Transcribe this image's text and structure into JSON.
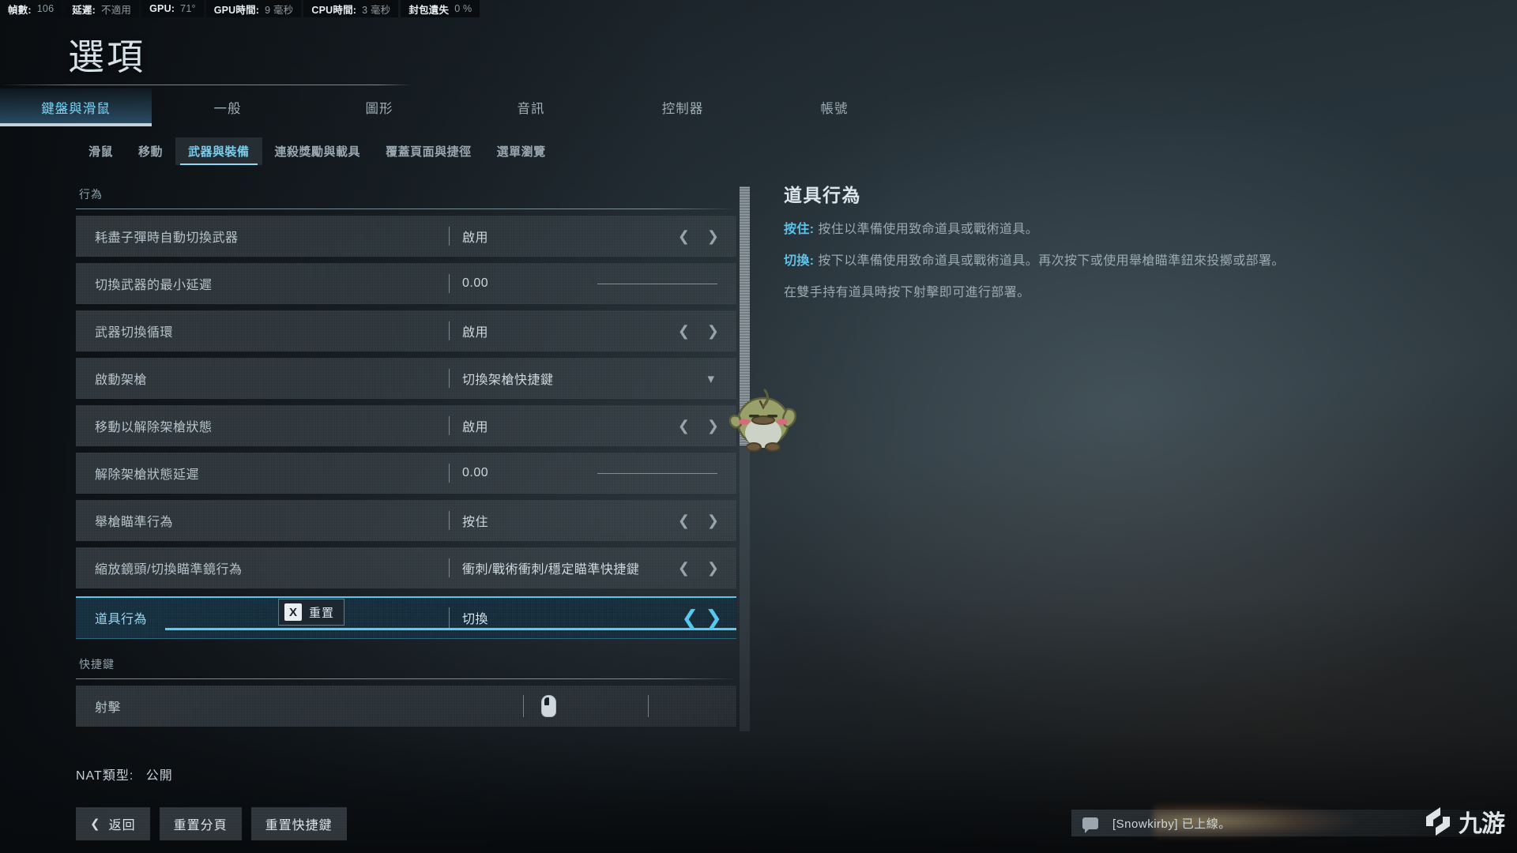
{
  "perf": [
    {
      "key": "幀數:",
      "value": "106"
    },
    {
      "key": "延遲:",
      "value": "不適用"
    },
    {
      "key": "GPU:",
      "value": "71°"
    },
    {
      "key": "GPU時間:",
      "value": "9 毫秒"
    },
    {
      "key": "CPU時間:",
      "value": "3 毫秒"
    },
    {
      "key": "封包遺失",
      "value": "0 %"
    }
  ],
  "header": {
    "title": "選項"
  },
  "tabs": [
    {
      "label": "鍵盤與滑鼠",
      "active": true
    },
    {
      "label": "一般",
      "active": false
    },
    {
      "label": "圖形",
      "active": false
    },
    {
      "label": "音訊",
      "active": false
    },
    {
      "label": "控制器",
      "active": false
    },
    {
      "label": "帳號",
      "active": false
    }
  ],
  "subtabs": [
    {
      "label": "滑鼠",
      "active": false
    },
    {
      "label": "移動",
      "active": false
    },
    {
      "label": "武器與裝備",
      "active": true
    },
    {
      "label": "連殺獎勵與載具",
      "active": false
    },
    {
      "label": "覆蓋頁面與捷徑",
      "active": false
    },
    {
      "label": "選單瀏覽",
      "active": false
    }
  ],
  "sections": {
    "behavior_title": "行為",
    "keybind_title": "快捷鍵"
  },
  "rows": [
    {
      "label": "耗盡子彈時自動切換武器",
      "value": "啟用",
      "control": "stepper"
    },
    {
      "label": "切換武器的最小延遲",
      "value": "0.00",
      "control": "slider"
    },
    {
      "label": "武器切換循環",
      "value": "啟用",
      "control": "stepper"
    },
    {
      "label": "啟動架槍",
      "value": "切換架槍快捷鍵",
      "control": "dropdown"
    },
    {
      "label": "移動以解除架槍狀態",
      "value": "啟用",
      "control": "stepper"
    },
    {
      "label": "解除架槍狀態延遲",
      "value": "0.00",
      "control": "slider"
    },
    {
      "label": "舉槍瞄準行為",
      "value": "按住",
      "control": "stepper"
    },
    {
      "label": "縮放鏡頭/切換瞄準鏡行為",
      "value": "衝刺/戰術衝刺/穩定瞄準快捷鍵",
      "control": "stepper"
    },
    {
      "label": "道具行為",
      "value": "切換",
      "control": "stepper",
      "selected": true
    }
  ],
  "keybind_rows": [
    {
      "label": "射擊",
      "binding_icon": "mouse-left-button-icon"
    }
  ],
  "reset_tooltip": {
    "key": "X",
    "label": "重置"
  },
  "description": {
    "title": "道具行為",
    "entries": [
      {
        "key": "按住:",
        "text": "按住以準備使用致命道具或戰術道具。"
      },
      {
        "key": "切換:",
        "text": "按下以準備使用致命道具或戰術道具。再次按下或使用舉槍瞄準鈕來投擲或部署。"
      }
    ],
    "note": "在雙手持有道具時按下射擊即可進行部署。"
  },
  "footer": {
    "nat_label": "NAT類型:",
    "nat_value": "公開",
    "buttons": [
      {
        "label": "返回",
        "icon": "chevron-left-icon"
      },
      {
        "label": "重置分頁",
        "icon": ""
      },
      {
        "label": "重置快捷鍵",
        "icon": ""
      }
    ]
  },
  "toast": {
    "text": "[Snowkirby] 已上線。"
  },
  "watermark": {
    "text": "九游"
  },
  "colors": {
    "accent": "#5ec3ea",
    "accent_bright": "#57c9ef",
    "tab_active_text": "#7fd4f5",
    "text_primary": "#ccd7de",
    "text_muted": "#9aa9b2",
    "panel_bg": "#1c2730"
  }
}
